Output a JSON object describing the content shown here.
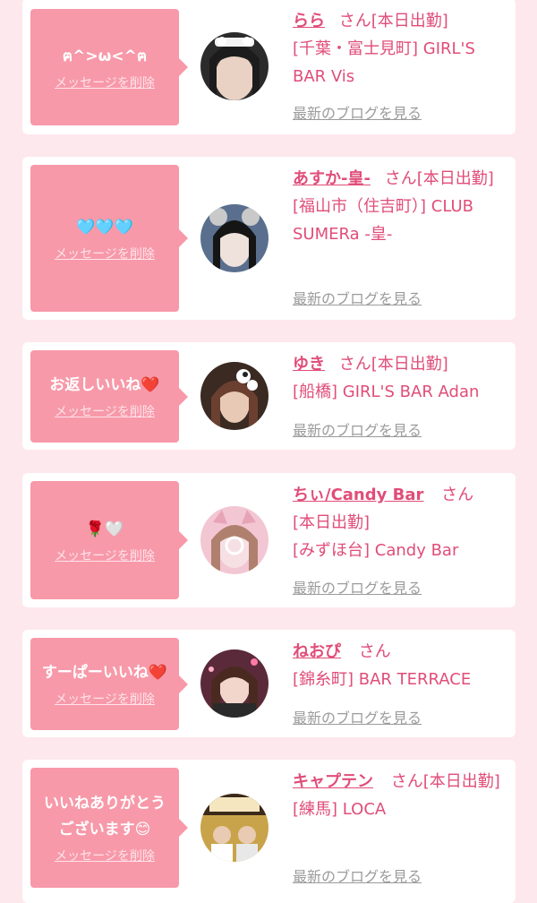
{
  "delete_label": "メッセージを削除",
  "blog_label": "最新のブログを見る",
  "san": "さん",
  "cards": [
    {
      "message": "ฅ^>ω<^ฅ",
      "name": "らら",
      "status": "[本日出勤]",
      "location": "[千葉・富士見町] GIRL'S BAR Vis"
    },
    {
      "message": "🩵🩵🩵",
      "name": "あすか-皇-",
      "status": "[本日出勤]",
      "location": "[福山市（住吉町）] CLUB SUMERa -皇-"
    },
    {
      "message": "お返しいいね❤️",
      "name": "ゆき",
      "status": "[本日出勤]",
      "location": "[船橋] GIRL'S BAR Adan"
    },
    {
      "message": "🌹🤍",
      "name": "ちぃ/Candy Bar",
      "status": "[本日出勤]",
      "location": "[みずほ台] Candy Bar"
    },
    {
      "message": "すーぱーいいね❤️",
      "name": "ねおぴ",
      "status": "",
      "location": "[錦糸町] BAR TERRACE"
    },
    {
      "message": "いいねありがとうございます😊",
      "name": "キャプテン",
      "status": "[本日出勤]",
      "location": "[練馬] LOCA"
    }
  ],
  "colors": {
    "page_bg": "#fde8ee",
    "bubble": "#f799a9",
    "name": "#e04d79",
    "link_gray": "#9b9b9b"
  }
}
